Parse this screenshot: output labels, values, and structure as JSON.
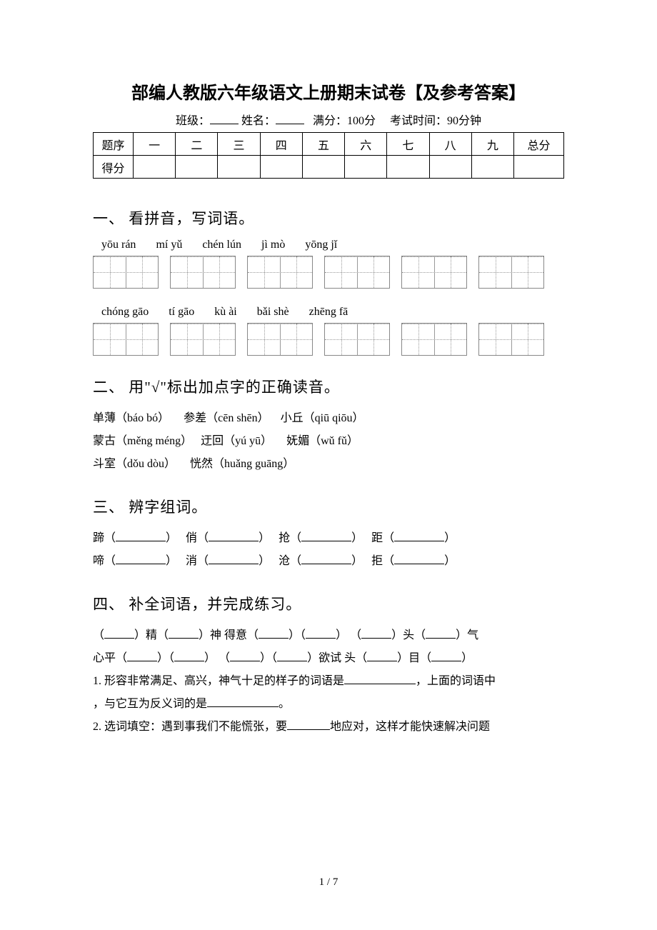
{
  "title": "部编人教版六年级语文上册期末试卷【及参考答案】",
  "meta": {
    "class_label": "班级：",
    "name_label": "姓名：",
    "full_label": "满分：100分",
    "time_label": "考试时间：90分钟"
  },
  "score_table": {
    "row1_label": "题序",
    "cols": [
      "一",
      "二",
      "三",
      "四",
      "五",
      "六",
      "七",
      "八",
      "九"
    ],
    "total_label": "总分",
    "row2_label": "得分"
  },
  "s1": {
    "heading": "一、 看拼音，写词语。",
    "row1": [
      "yōu rán",
      "mí yǔ",
      "chén lún",
      "jì mò",
      "yōng jǐ"
    ],
    "row2": [
      "chóng gāo",
      "tí gāo",
      "kù ài",
      "bǎi shè",
      "zhēng fā"
    ]
  },
  "s2": {
    "heading": "二、 用\"√\"标出加点字的正确读音。",
    "lines": [
      [
        "单薄（báo  bó）",
        "参差（cēn  shēn）",
        "小丘（qiū  qiōu）"
      ],
      [
        "蒙古（měng  méng）",
        "迂回（yú  yū）",
        "妩媚（wǔ  fǔ）"
      ],
      [
        "斗室（dǒu  dòu）",
        "恍然（huǎng  guāng）"
      ]
    ]
  },
  "s3": {
    "heading": "三、 辨字组词。",
    "pairs": [
      [
        "蹄",
        "俏",
        "抢",
        "距"
      ],
      [
        "啼",
        "消",
        "沧",
        "拒"
      ]
    ]
  },
  "s4": {
    "heading": "四、 补全词语，并完成练习。",
    "line1_parts": [
      "（",
      "）精（",
      "）神   得意（",
      "）（",
      "）  （",
      "）头（",
      "）气"
    ],
    "line2_parts": [
      "心平（",
      "）（",
      "）  （",
      "）（",
      "）欲试   头（",
      "）目（",
      "）"
    ],
    "q1_a": "1. 形容非常满足、高兴，神气十足的样子的词语是",
    "q1_b": "，上面的词语中",
    "q1_c": "，与它互为反义词的是",
    "q1_d": "。",
    "q2_a": "2. 选词填空：遇到事我们不能慌张，要",
    "q2_b": "地应对，这样才能快速解决问题"
  },
  "footer": "1 / 7"
}
